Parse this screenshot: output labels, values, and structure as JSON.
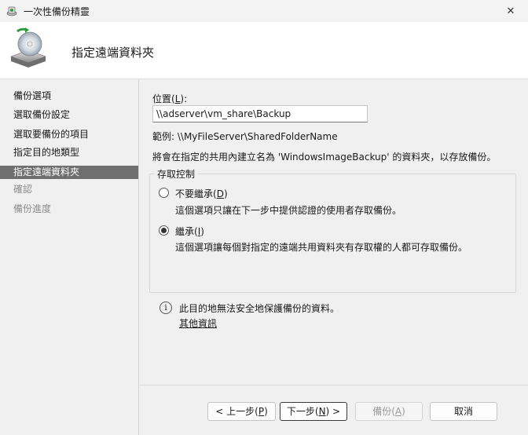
{
  "window": {
    "title": "一次性備份精靈",
    "close_label": "✕"
  },
  "header": {
    "title": "指定遠端資料夾"
  },
  "sidebar": {
    "items": [
      {
        "label": "備份選項",
        "state": "normal"
      },
      {
        "label": "選取備份設定",
        "state": "normal"
      },
      {
        "label": "選取要備份的項目",
        "state": "normal"
      },
      {
        "label": "指定目的地類型",
        "state": "normal"
      },
      {
        "label": "指定遠端資料夾",
        "state": "active"
      },
      {
        "label": "確認",
        "state": "disabled"
      },
      {
        "label": "備份進度",
        "state": "disabled"
      }
    ]
  },
  "location": {
    "label": "位置",
    "access_key": "L",
    "value": "\\\\adserver\\vm_share\\Backup",
    "example": "範例: \\\\MyFileServer\\SharedFolderName",
    "description": "將會在指定的共用內建立名為 'WindowsImageBackup' 的資料夾，以存放備份。"
  },
  "access_control": {
    "group_label": "存取控制",
    "options": [
      {
        "label": "不要繼承",
        "access_key": "D",
        "description": "這個選項只讓在下一步中提供認證的使用者存取備份。",
        "checked": false
      },
      {
        "label": "繼承",
        "access_key": "I",
        "description": "這個選項讓每個對指定的遠端共用資料夾有存取權的人都可存取備份。",
        "checked": true
      }
    ]
  },
  "security_note": {
    "text": "此目的地無法安全地保護備份的資料。",
    "link": "其他資訊"
  },
  "buttons": {
    "back": {
      "pre": "< 上一步(",
      "key": "P",
      "post": ")"
    },
    "next": {
      "pre": "下一步(",
      "key": "N",
      "post": ") >"
    },
    "backup": {
      "pre": "備份(",
      "key": "A",
      "post": ")"
    },
    "cancel": {
      "label": "取消"
    }
  }
}
